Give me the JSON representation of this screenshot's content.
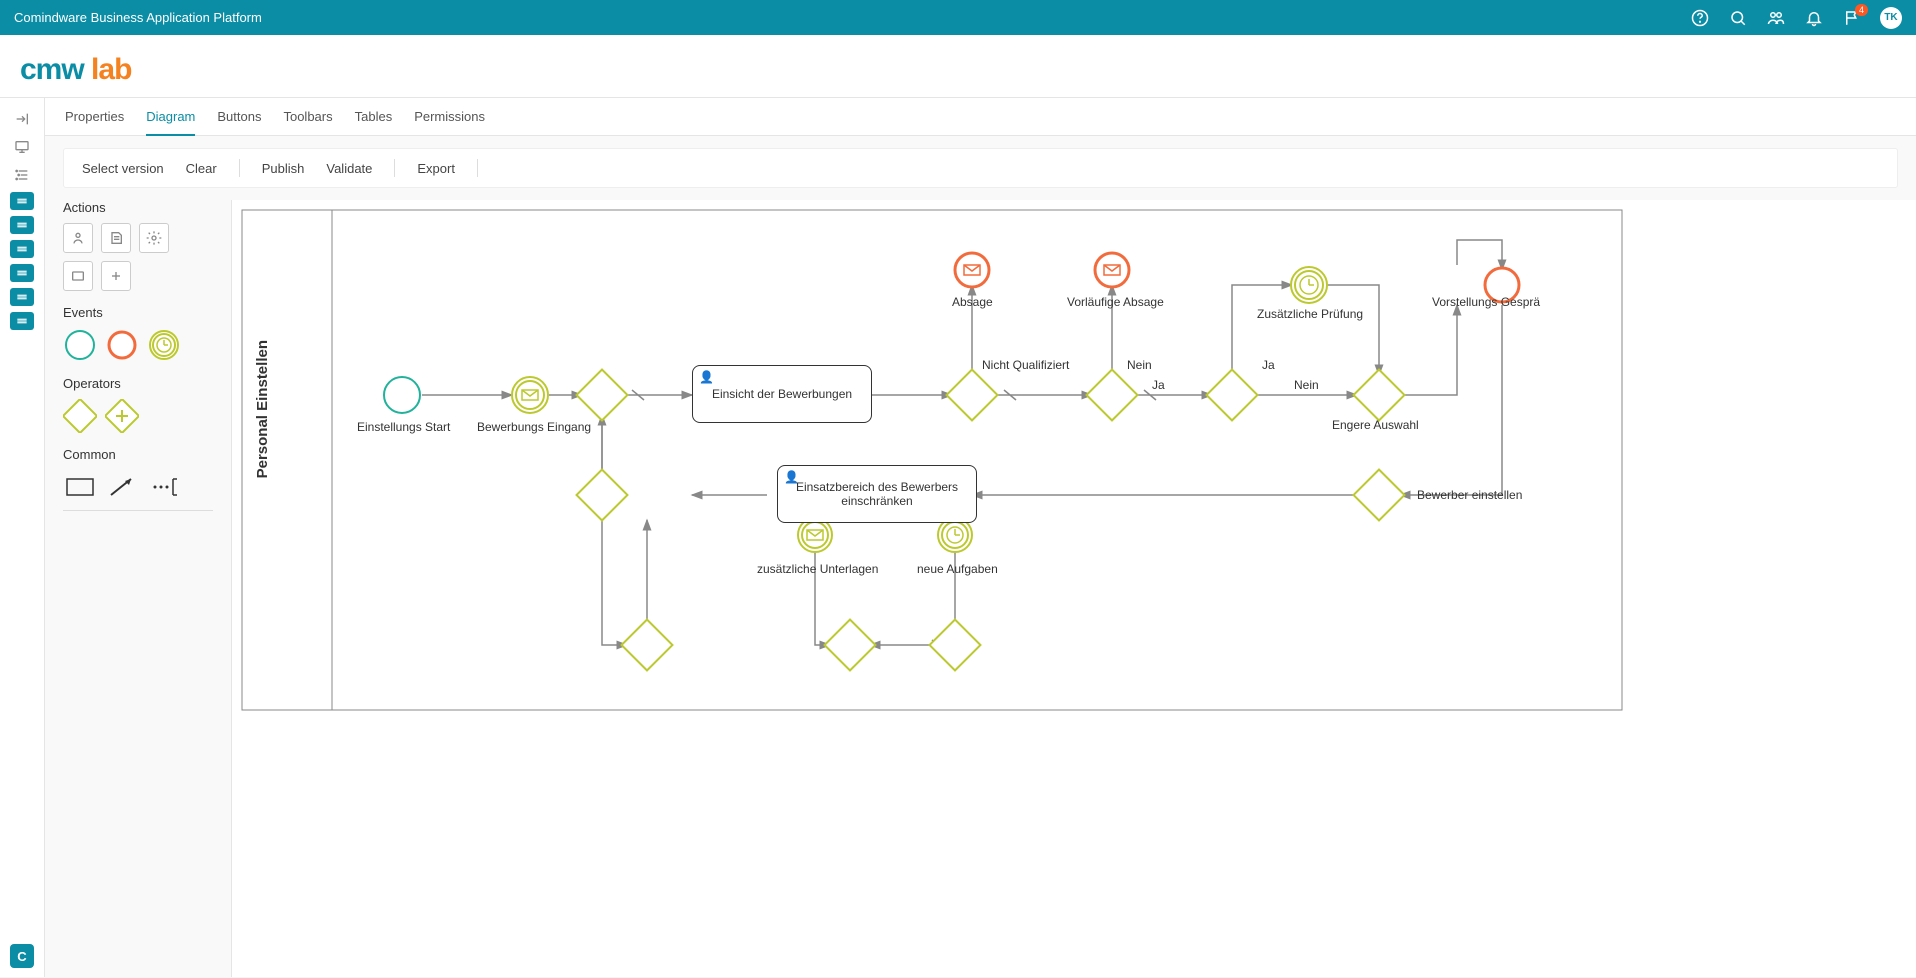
{
  "app": {
    "title": "Comindware Business Application Platform",
    "user_initials": "TK",
    "notification_count": "4"
  },
  "logo": {
    "part1": "cmw",
    "part2": "lab"
  },
  "tabs": [
    {
      "label": "Properties"
    },
    {
      "label": "Diagram",
      "active": true
    },
    {
      "label": "Buttons"
    },
    {
      "label": "Toolbars"
    },
    {
      "label": "Tables"
    },
    {
      "label": "Permissions"
    }
  ],
  "actions": [
    {
      "label": "Select version"
    },
    {
      "label": "Clear"
    },
    {
      "label": "Publish"
    },
    {
      "label": "Validate"
    },
    {
      "label": "Export"
    }
  ],
  "palette": {
    "actions_title": "Actions",
    "events_title": "Events",
    "operators_title": "Operators",
    "common_title": "Common"
  },
  "diagram": {
    "pool_name": "Personal Einstellen",
    "nodes": {
      "start": "Einstellungs Start",
      "msg_in": "Bewerbungs Eingang",
      "task1": "Einsicht der Bewerbungen",
      "task2": "Einsatzbereich des Bewerbers einschränken",
      "end1": "Absage",
      "end2": "Vorläufige Absage",
      "timer1": "Zusätzliche Prüfung",
      "end3": "Vorstellungs Gesprä",
      "docs_evt": "zusätzliche Unterlagen",
      "tasks_evt": "neue Aufgaben",
      "gw7_label": "Engere Auswahl",
      "gw8_label": "Bewerber einstellen"
    },
    "edges": {
      "not_qualified": "Nicht Qualifiziert",
      "nein1": "Nein",
      "ja1": "Ja",
      "ja2": "Ja",
      "nein2": "Nein"
    }
  }
}
